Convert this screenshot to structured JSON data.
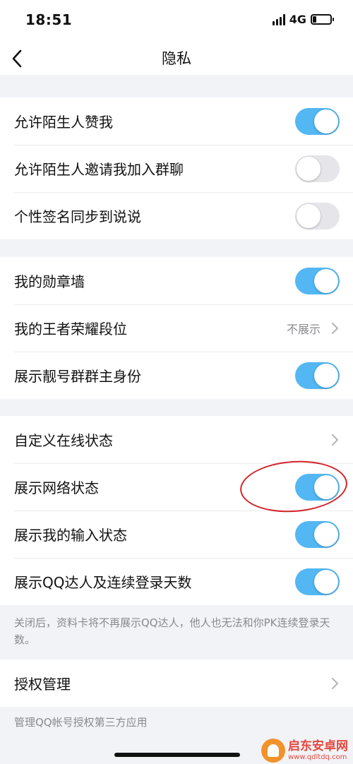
{
  "status_bar": {
    "time": "18:51",
    "network": "4G"
  },
  "nav": {
    "title": "隐私"
  },
  "group1": [
    {
      "label": "允许陌生人赞我",
      "toggle": "on"
    },
    {
      "label": "允许陌生人邀请我加入群聊",
      "toggle": "off"
    },
    {
      "label": "个性签名同步到说说",
      "toggle": "off"
    }
  ],
  "group2": [
    {
      "label": "我的勋章墙",
      "toggle": "on"
    },
    {
      "label": "我的王者荣耀段位",
      "value": "不展示"
    },
    {
      "label": "展示靓号群群主身份",
      "toggle": "on"
    }
  ],
  "group3": [
    {
      "label": "自定义在线状态"
    },
    {
      "label": "展示网络状态",
      "toggle": "on"
    },
    {
      "label": "展示我的输入状态",
      "toggle": "on"
    },
    {
      "label": "展示QQ达人及连续登录天数",
      "toggle": "on"
    }
  ],
  "group3_note": "关闭后，资料卡将不再展示QQ达人，他人也无法和你PK连续登录天数。",
  "group4": [
    {
      "label": "授权管理"
    }
  ],
  "group4_note": "管理QQ帐号授权第三方应用",
  "watermark": {
    "title": "启东安卓网",
    "url": "www.qdltdq.com"
  },
  "colors": {
    "toggle_on": "#52b7f2",
    "toggle_off": "#e6e6ea",
    "annotation": "#d2232a"
  }
}
